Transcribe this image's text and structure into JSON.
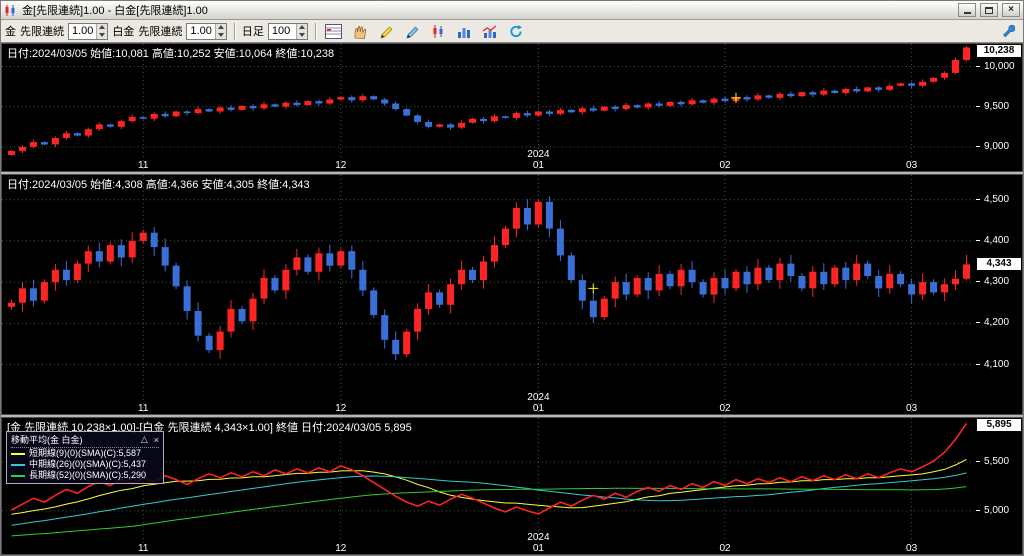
{
  "window": {
    "title": "金[先限連続]1.00 - 白金[先限連続]1.00"
  },
  "titlebar_buttons": {
    "minimize": "minimize",
    "maximize": "maximize",
    "close": "×"
  },
  "toolbar": {
    "symbol1_label": "金",
    "series1_label": "先限連続",
    "ratio1_value": "1.00",
    "symbol2_label": "白金",
    "series2_label": "先限連続",
    "ratio2_value": "1.00",
    "period_label": "日足",
    "bars_value": "100"
  },
  "colors": {
    "up": "#ff2424",
    "down": "#3a6fd8",
    "grid": "#36604a",
    "main_line": "#ff2222",
    "badge_bg": "#ffffff",
    "text": "#ffffff"
  },
  "months": [
    {
      "label": "11",
      "i": 12
    },
    {
      "label": "12",
      "i": 30
    },
    {
      "label": "01",
      "i": 48,
      "year": "2024"
    },
    {
      "label": "02",
      "i": 65
    },
    {
      "label": "03",
      "i": 82
    }
  ],
  "chart_data": [
    {
      "type": "candlestick",
      "title": "金 先限連続 日足",
      "ylim": [
        8700,
        10280
      ],
      "last_ohlc": [
        10081,
        10252,
        10064,
        10238
      ]
    },
    {
      "type": "candlestick",
      "title": "白金 先限連続 日足",
      "ylim": [
        3980,
        4560
      ],
      "last_ohlc": [
        4308,
        4366,
        4305,
        4343
      ]
    },
    {
      "type": "line",
      "title": "金-白金 スプレッド 終値",
      "ylim": [
        4560,
        5950
      ],
      "last_value": 5895,
      "sma_windows": [
        9,
        26,
        52
      ]
    }
  ],
  "panels": [
    {
      "id": "gold",
      "type": "candle",
      "info": "日付:2024/03/05 始値:10,081 高値:10,252 安値:10,064 終値:10,238",
      "last_label": "10,238",
      "last_value": 10238,
      "y_range": [
        8700,
        10280
      ],
      "y_ticks": [
        {
          "v": 10000,
          "label": "10,000"
        },
        {
          "v": 9500,
          "label": "9,500"
        },
        {
          "v": 9000,
          "label": "9,000"
        }
      ],
      "first_open": 8900,
      "wick": 10,
      "last_ohlc": [
        10081,
        10252,
        10064,
        10238
      ],
      "cross": {
        "i": 66,
        "v": 9610
      },
      "closes": [
        8950,
        9000,
        9060,
        9030,
        9110,
        9170,
        9140,
        9220,
        9280,
        9250,
        9320,
        9370,
        9350,
        9410,
        9380,
        9440,
        9420,
        9470,
        9440,
        9490,
        9460,
        9510,
        9480,
        9530,
        9500,
        9550,
        9520,
        9570,
        9540,
        9590,
        9620,
        9580,
        9630,
        9590,
        9540,
        9470,
        9390,
        9310,
        9250,
        9280,
        9240,
        9300,
        9350,
        9320,
        9380,
        9360,
        9420,
        9390,
        9440,
        9410,
        9460,
        9430,
        9480,
        9450,
        9500,
        9470,
        9520,
        9490,
        9540,
        9510,
        9560,
        9530,
        9580,
        9550,
        9600,
        9570,
        9620,
        9590,
        9640,
        9610,
        9660,
        9630,
        9680,
        9650,
        9700,
        9670,
        9720,
        9690,
        9740,
        9710,
        9760,
        9790,
        9760,
        9810,
        9860,
        9920,
        10081,
        10238
      ]
    },
    {
      "id": "platinum",
      "type": "candle",
      "info": "日付:2024/03/05 始値:4,308 高値:4,366 安値:4,305 終値:4,343",
      "last_label": "4,343",
      "last_value": 4343,
      "y_range": [
        3980,
        4560
      ],
      "y_ticks": [
        {
          "v": 4500,
          "label": "4,500"
        },
        {
          "v": 4400,
          "label": "4,400"
        },
        {
          "v": 4300,
          "label": "4,300"
        },
        {
          "v": 4200,
          "label": "4,200"
        },
        {
          "v": 4100,
          "label": "4,100"
        }
      ],
      "first_open": 4240,
      "wick": 7,
      "last_ohlc": [
        4308,
        4366,
        4305,
        4343
      ],
      "cross": {
        "i": 53,
        "v": 4285
      },
      "closes": [
        4250,
        4285,
        4255,
        4300,
        4330,
        4305,
        4345,
        4375,
        4350,
        4390,
        4360,
        4400,
        4420,
        4385,
        4340,
        4290,
        4230,
        4170,
        4135,
        4180,
        4235,
        4205,
        4260,
        4310,
        4280,
        4330,
        4360,
        4325,
        4370,
        4340,
        4375,
        4330,
        4280,
        4220,
        4160,
        4125,
        4180,
        4235,
        4275,
        4245,
        4295,
        4330,
        4305,
        4350,
        4390,
        4430,
        4480,
        4440,
        4495,
        4430,
        4365,
        4305,
        4255,
        4215,
        4260,
        4300,
        4270,
        4310,
        4280,
        4320,
        4290,
        4330,
        4300,
        4270,
        4310,
        4285,
        4325,
        4295,
        4335,
        4305,
        4345,
        4315,
        4285,
        4325,
        4295,
        4335,
        4305,
        4345,
        4315,
        4285,
        4320,
        4295,
        4270,
        4300,
        4275,
        4295,
        4308,
        4343
      ]
    },
    {
      "id": "spread",
      "type": "line",
      "info": "[金 先限連続 10,238×1.00]-[白金 先限連続 4,343×1.00] 終値 日付:2024/03/05 5,895",
      "last_label": "5,895",
      "last_value": 5895,
      "y_range": [
        4560,
        5950
      ],
      "y_ticks": [
        {
          "v": 5500,
          "label": "5,500"
        },
        {
          "v": 5000,
          "label": "5,000"
        }
      ],
      "legend": {
        "title": "移動平均(金 白金)",
        "collapse": "△",
        "close": "×",
        "items": [
          {
            "label": "短期線(9)(0)(SMA)(C):5,587",
            "color": "#ffff33",
            "name": "ma-short-line"
          },
          {
            "label": "中期線(26)(0)(SMA)(C):5,437",
            "color": "#33cccc",
            "name": "ma-mid-line"
          },
          {
            "label": "長期線(52)(0)(SMA)(C):5,290",
            "color": "#33cc33",
            "name": "ma-long-line"
          }
        ]
      },
      "ma": [
        {
          "window": 9,
          "color": "#ffff33",
          "name": "ma-short-line"
        },
        {
          "window": 26,
          "color": "#33cccc",
          "name": "ma-mid-line"
        },
        {
          "window": 52,
          "color": "#33cc33",
          "name": "ma-long-line"
        }
      ],
      "pre": [
        4450,
        4465,
        4480,
        4495,
        4510,
        4525,
        4540,
        4555,
        4570,
        4585,
        4600,
        4615,
        4630,
        4645,
        4660,
        4675,
        4690,
        4705,
        4720,
        4735,
        4750,
        4765,
        4780,
        4795,
        4810,
        4825,
        4840,
        4855,
        4870,
        4885,
        4900,
        4915,
        4930,
        4940,
        4950,
        4958,
        4966,
        4974,
        4982,
        4995
      ],
      "closes": [
        5010,
        5070,
        5130,
        5090,
        5160,
        5220,
        5180,
        5250,
        5300,
        5260,
        5320,
        5280,
        5340,
        5300,
        5360,
        5320,
        5270,
        5330,
        5380,
        5340,
        5390,
        5350,
        5400,
        5360,
        5420,
        5380,
        5430,
        5390,
        5440,
        5400,
        5460,
        5420,
        5360,
        5290,
        5220,
        5150,
        5090,
        5050,
        5100,
        5060,
        5120,
        5170,
        5130,
        5080,
        5030,
        4990,
        5040,
        5000,
        4970,
        5030,
        5090,
        5050,
        5110,
        5160,
        5120,
        5180,
        5140,
        5200,
        5240,
        5200,
        5260,
        5220,
        5280,
        5240,
        5300,
        5260,
        5320,
        5280,
        5330,
        5290,
        5340,
        5300,
        5350,
        5310,
        5360,
        5320,
        5370,
        5330,
        5380,
        5340,
        5390,
        5430,
        5400,
        5450,
        5510,
        5600,
        5730,
        5895
      ]
    }
  ]
}
